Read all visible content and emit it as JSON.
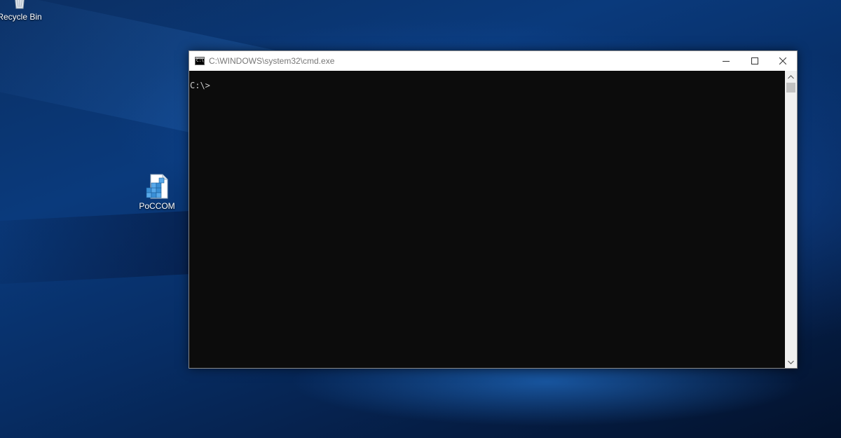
{
  "desktop": {
    "icons": [
      {
        "label": "Recycle Bin",
        "icon": "recycle-bin-icon"
      },
      {
        "label": "PoCCOM",
        "icon": "registry-file-icon"
      }
    ]
  },
  "cmd_window": {
    "title": "C:\\WINDOWS\\system32\\cmd.exe",
    "icon": "cmd-icon",
    "controls": {
      "minimize": "minimize-icon",
      "maximize": "maximize-icon",
      "close": "close-icon"
    },
    "console_text": "C:\\>",
    "colors": {
      "console_bg": "#0c0c0c",
      "console_fg": "#cccccc",
      "title_bar_bg": "#ffffff"
    }
  }
}
